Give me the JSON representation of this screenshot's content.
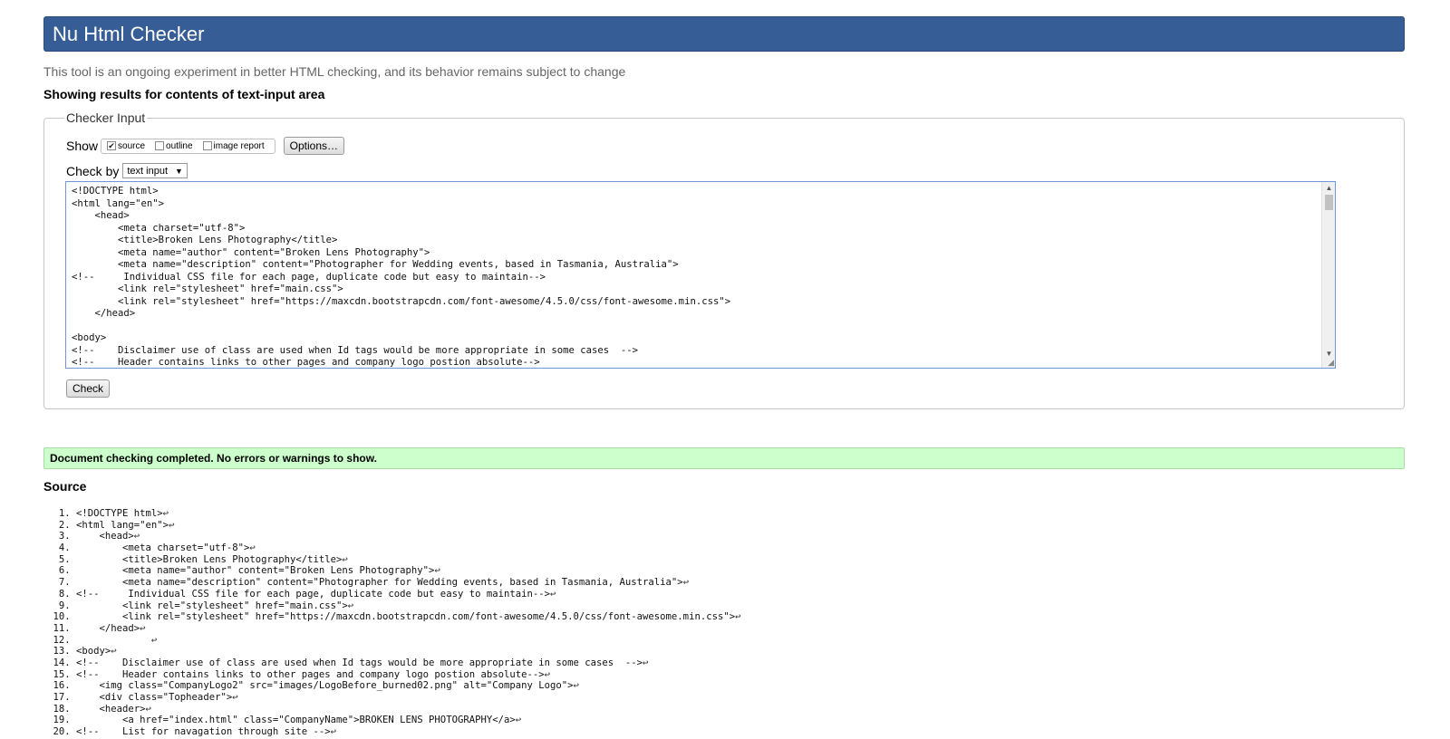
{
  "header": {
    "title": "Nu Html Checker",
    "subtitle": "This tool is an ongoing experiment in better HTML checking, and its behavior remains subject to change",
    "results_for": "Showing results for contents of text-input area"
  },
  "checker_input": {
    "legend": "Checker Input",
    "show_label": "Show",
    "show_options": [
      {
        "label": "source",
        "checked": true
      },
      {
        "label": "outline",
        "checked": false
      },
      {
        "label": "image report",
        "checked": false
      }
    ],
    "options_button": "Options…",
    "check_by_label": "Check by",
    "check_by_value": "text input",
    "textarea_lines": [
      "<!DOCTYPE html>",
      "<html lang=\"en\">",
      "    <head>",
      "        <meta charset=\"utf-8\">",
      "        <title>Broken Lens Photography</title>",
      "        <meta name=\"author\" content=\"Broken Lens Photography\">",
      "        <meta name=\"description\" content=\"Photographer for Wedding events, based in Tasmania, Australia\">",
      "<!--     Individual CSS file for each page, duplicate code but easy to maintain-->",
      "        <link rel=\"stylesheet\" href=\"main.css\">",
      "        <link rel=\"stylesheet\" href=\"https://maxcdn.bootstrapcdn.com/font-awesome/4.5.0/css/font-awesome.min.css\">",
      "    </head>",
      "",
      "<body>",
      "<!--    Disclaimer use of class are used when Id tags would be more appropriate in some cases  -->",
      "<!--    Header contains links to other pages and company logo postion absolute-->"
    ],
    "check_button": "Check"
  },
  "result": {
    "message": "Document checking completed. No errors or warnings to show."
  },
  "source": {
    "heading": "Source",
    "line_end_symbol": "↩",
    "lines": [
      "<!DOCTYPE html>",
      "<html lang=\"en\">",
      "    <head>",
      "        <meta charset=\"utf-8\">",
      "        <title>Broken Lens Photography</title>",
      "        <meta name=\"author\" content=\"Broken Lens Photography\">",
      "        <meta name=\"description\" content=\"Photographer for Wedding events, based in Tasmania, Australia\">",
      "<!--     Individual CSS file for each page, duplicate code but easy to maintain-->",
      "        <link rel=\"stylesheet\" href=\"main.css\">",
      "        <link rel=\"stylesheet\" href=\"https://maxcdn.bootstrapcdn.com/font-awesome/4.5.0/css/font-awesome.min.css\">",
      "    </head>",
      "             ",
      "<body>",
      "<!--    Disclaimer use of class are used when Id tags would be more appropriate in some cases  -->",
      "<!--    Header contains links to other pages and company logo postion absolute-->",
      "    <img class=\"CompanyLogo2\" src=\"images/LogoBefore_burned02.png\" alt=\"Company Logo\">",
      "    <div class=\"Topheader\">",
      "    <header>",
      "        <a href=\"index.html\" class=\"CompanyName\">BROKEN LENS PHOTOGRAPHY</a>",
      "<!--    List for navagation through site -->"
    ]
  }
}
